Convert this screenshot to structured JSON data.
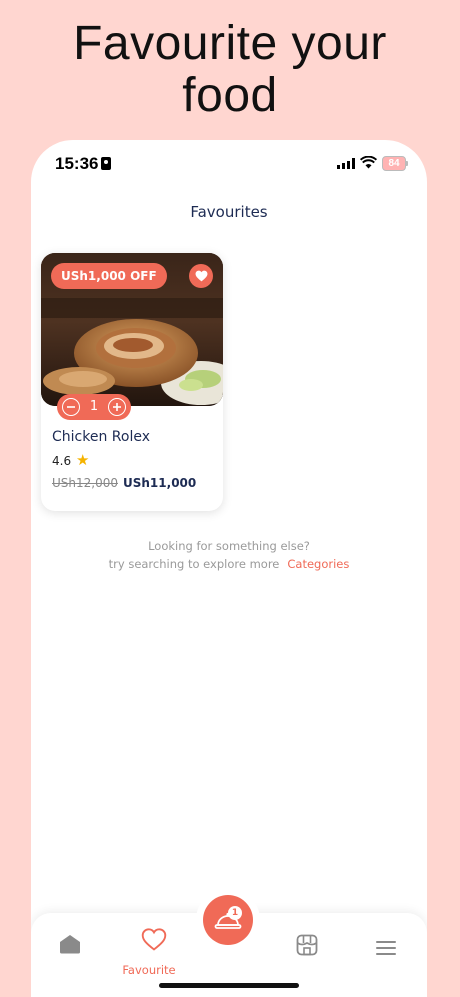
{
  "headline": {
    "line1": "Favourite your",
    "line2": "food"
  },
  "status_bar": {
    "time": "15:36",
    "battery": "84"
  },
  "header": {
    "title": "Favourites"
  },
  "favourites": [
    {
      "discount": "USh1,000 OFF",
      "name": "Chicken Rolex",
      "rating": "4.6",
      "old_price": "USh12,000",
      "price": "USh11,000",
      "quantity": "1",
      "favorited": true
    }
  ],
  "hint": {
    "line1": "Looking for something else?",
    "line2": "try searching to explore more",
    "link": "Categories"
  },
  "bottom_nav": {
    "favourite_label": "Favourite",
    "cart_count": "1",
    "items": [
      "home-icon",
      "heart-icon",
      "cart-icon",
      "store-icon",
      "menu-icon"
    ]
  },
  "colors": {
    "accent": "#F06A57",
    "background": "#FFD6D0",
    "navy": "#1D2B53"
  }
}
